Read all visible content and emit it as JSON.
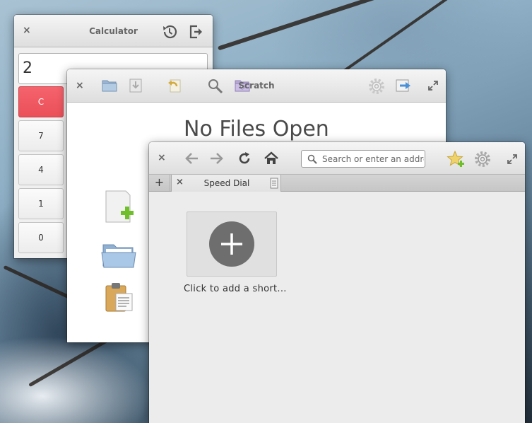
{
  "calculator": {
    "title": "Calculator",
    "display_value": "2",
    "keys": [
      "C",
      "7",
      "4",
      "1",
      "0"
    ]
  },
  "scratch": {
    "title": "Scratch",
    "welcome_heading": "No Files Open"
  },
  "browser": {
    "address_placeholder": "Search or enter an address",
    "tabs": [
      {
        "label": "Speed Dial"
      }
    ],
    "speed_dial": {
      "add_label": "Click to add a short..."
    }
  },
  "colors": {
    "clear_key": "#eb4f58",
    "window_bg": "#fafafa",
    "titlebar": "#dedede",
    "dial_circle": "#6e6e6e"
  },
  "icons": [
    "close-icon",
    "history-icon",
    "exit-icon",
    "folder-icon",
    "save-icon",
    "revert-icon",
    "search-icon",
    "project-folder-icon",
    "gear-icon",
    "share-icon",
    "maximize-icon",
    "back-arrow-icon",
    "forward-arrow-icon",
    "reload-icon",
    "home-icon",
    "bookmark-star-icon",
    "new-tab-icon",
    "tab-close-icon",
    "page-icon",
    "new-file-icon",
    "open-folder-icon",
    "clipboard-icon",
    "plus-icon"
  ]
}
